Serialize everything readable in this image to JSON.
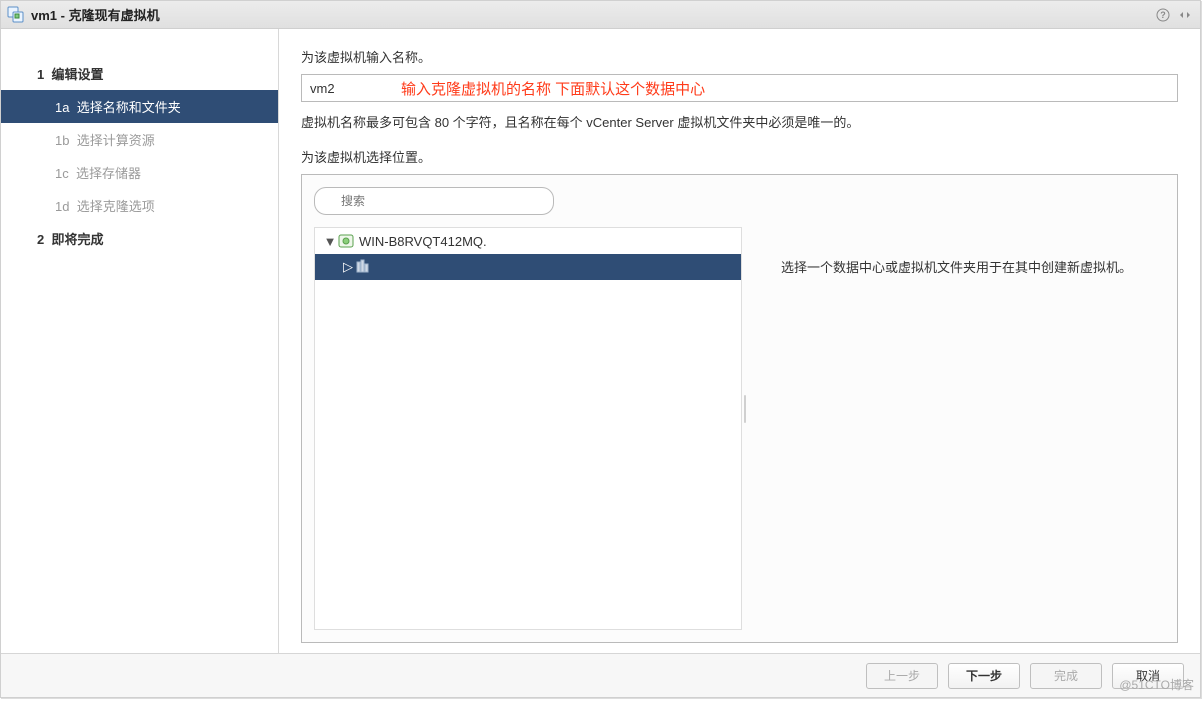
{
  "window": {
    "title": "vm1 - 克隆现有虚拟机"
  },
  "steps": {
    "s1": {
      "num": "1",
      "label": "编辑设置"
    },
    "s1a": {
      "num": "1a",
      "label": "选择名称和文件夹"
    },
    "s1b": {
      "num": "1b",
      "label": "选择计算资源"
    },
    "s1c": {
      "num": "1c",
      "label": "选择存储器"
    },
    "s1d": {
      "num": "1d",
      "label": "选择克隆选项"
    },
    "s2": {
      "num": "2",
      "label": "即将完成"
    }
  },
  "main": {
    "name_prompt": "为该虚拟机输入名称。",
    "name_value": "vm2",
    "annotation": "输入克隆虚拟机的名称    下面默认这个数据中心",
    "name_note": "虚拟机名称最多可包含 80 个字符，且名称在每个 vCenter Server 虚拟机文件夹中必须是唯一的。",
    "loc_prompt": "为该虚拟机选择位置。",
    "search_placeholder": "搜索",
    "tree": {
      "root": "WIN-B8RVQT412MQ.",
      "child": ""
    },
    "hint": "选择一个数据中心或虚拟机文件夹用于在其中创建新虚拟机。"
  },
  "footer": {
    "back": "上一步",
    "next": "下一步",
    "finish": "完成",
    "cancel": "取消"
  },
  "watermark": "@51CTO博客"
}
